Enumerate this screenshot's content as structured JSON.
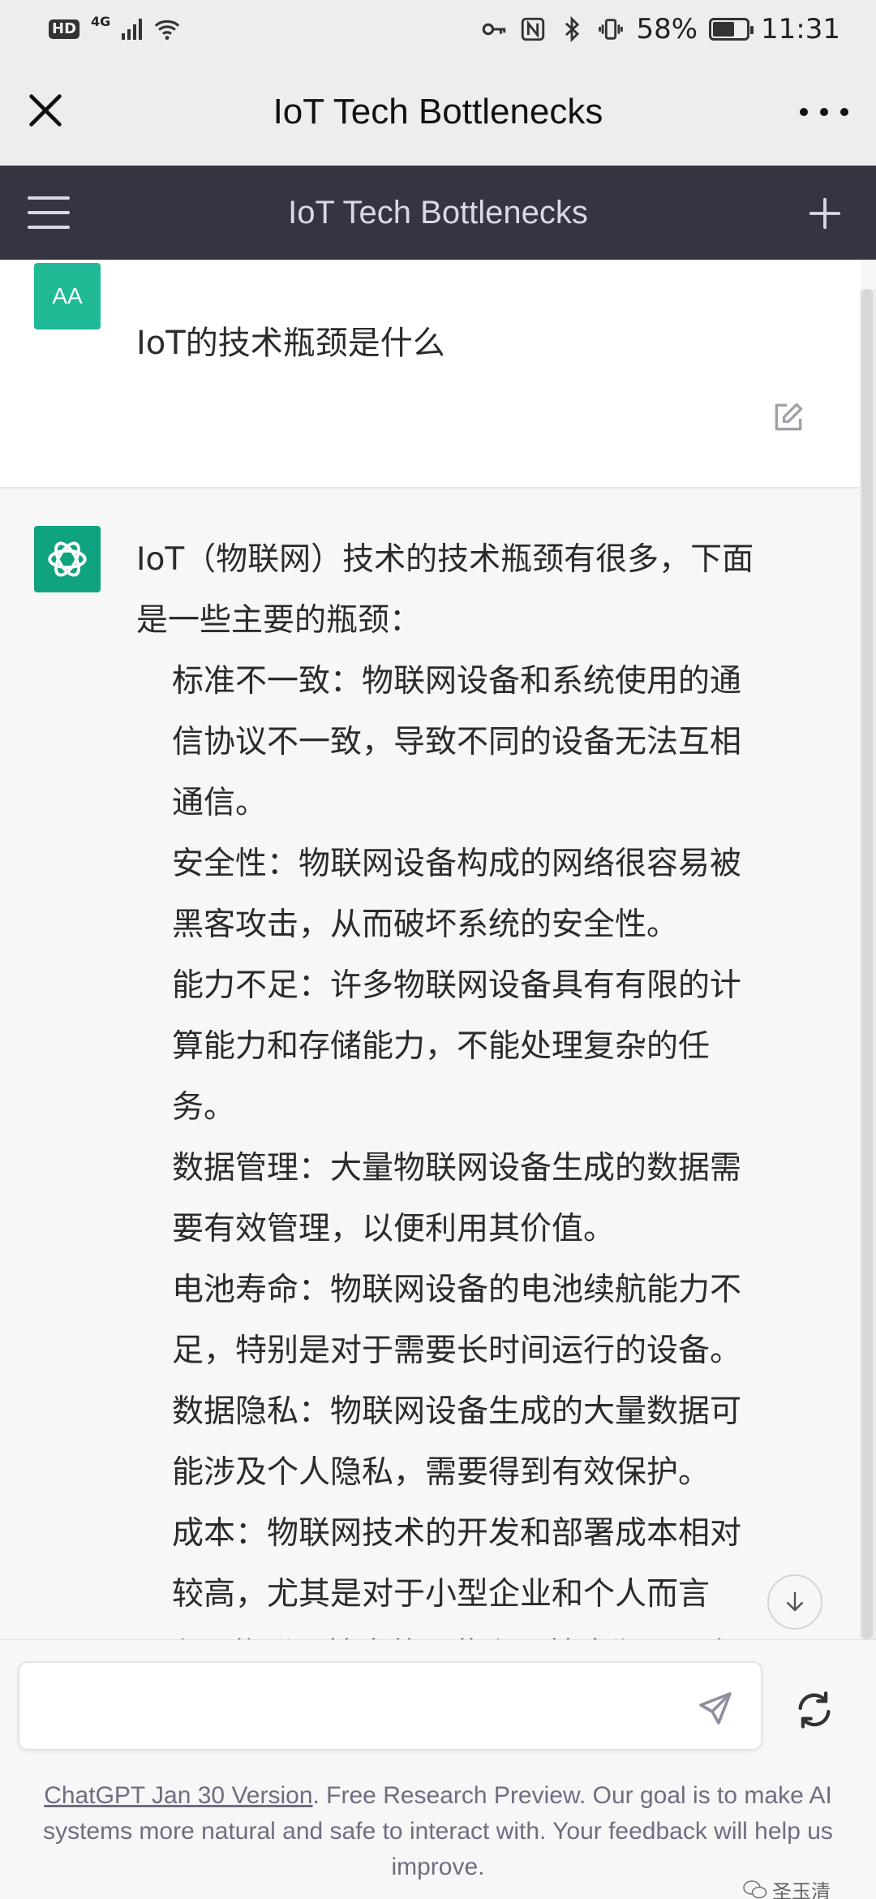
{
  "status_bar": {
    "network": "4G",
    "battery": "58%",
    "time": "11:31"
  },
  "top_bar": {
    "title": "IoT Tech Bottlenecks"
  },
  "app_bar": {
    "title": "IoT Tech Bottlenecks"
  },
  "conversation": {
    "user": {
      "avatar_initials": "AA",
      "message": "IoT的技术瓶颈是什么"
    },
    "assistant": {
      "intro_lines": [
        "IoT（物联网）技术的技术瓶颈有很多，下面",
        "是一些主要的瓶颈："
      ],
      "list_lines": [
        "标准不一致：物联网设备和系统使用的通",
        "信协议不一致，导致不同的设备无法互相",
        "通信。",
        "安全性：物联网设备构成的网络很容易被",
        "黑客攻击，从而破坏系统的安全性。",
        "能力不足：许多物联网设备具有有限的计",
        "算能力和存储能力，不能处理复杂的任",
        "务。",
        "数据管理：大量物联网设备生成的数据需",
        "要有效管理，以便利用其价值。",
        "电池寿命：物联网设备的电池续航能力不",
        "足，特别是对于需要长时间运行的设备。",
        "数据隐私：物联网设备生成的大量数据可",
        "能涉及个人隐私，需要得到有效保护。",
        "成本：物联网技术的开发和部署成本相对",
        "较高，尤其是对于小型企业和个人而言"
      ],
      "clipped_line": "以上是物联网技术的一些主要技术瓶颈，在"
    }
  },
  "input": {
    "value": "",
    "placeholder": ""
  },
  "footer": {
    "link_text": "ChatGPT Jan 30 Version",
    "text": ". Free Research Preview. Our goal is to make AI systems more natural and safe to interact with. Your feedback will help us improve."
  },
  "watermark": {
    "text": "圣玉清"
  },
  "colors": {
    "app_header": "#343541",
    "brand_green": "#10a37f",
    "user_avatar": "#1fb996"
  }
}
